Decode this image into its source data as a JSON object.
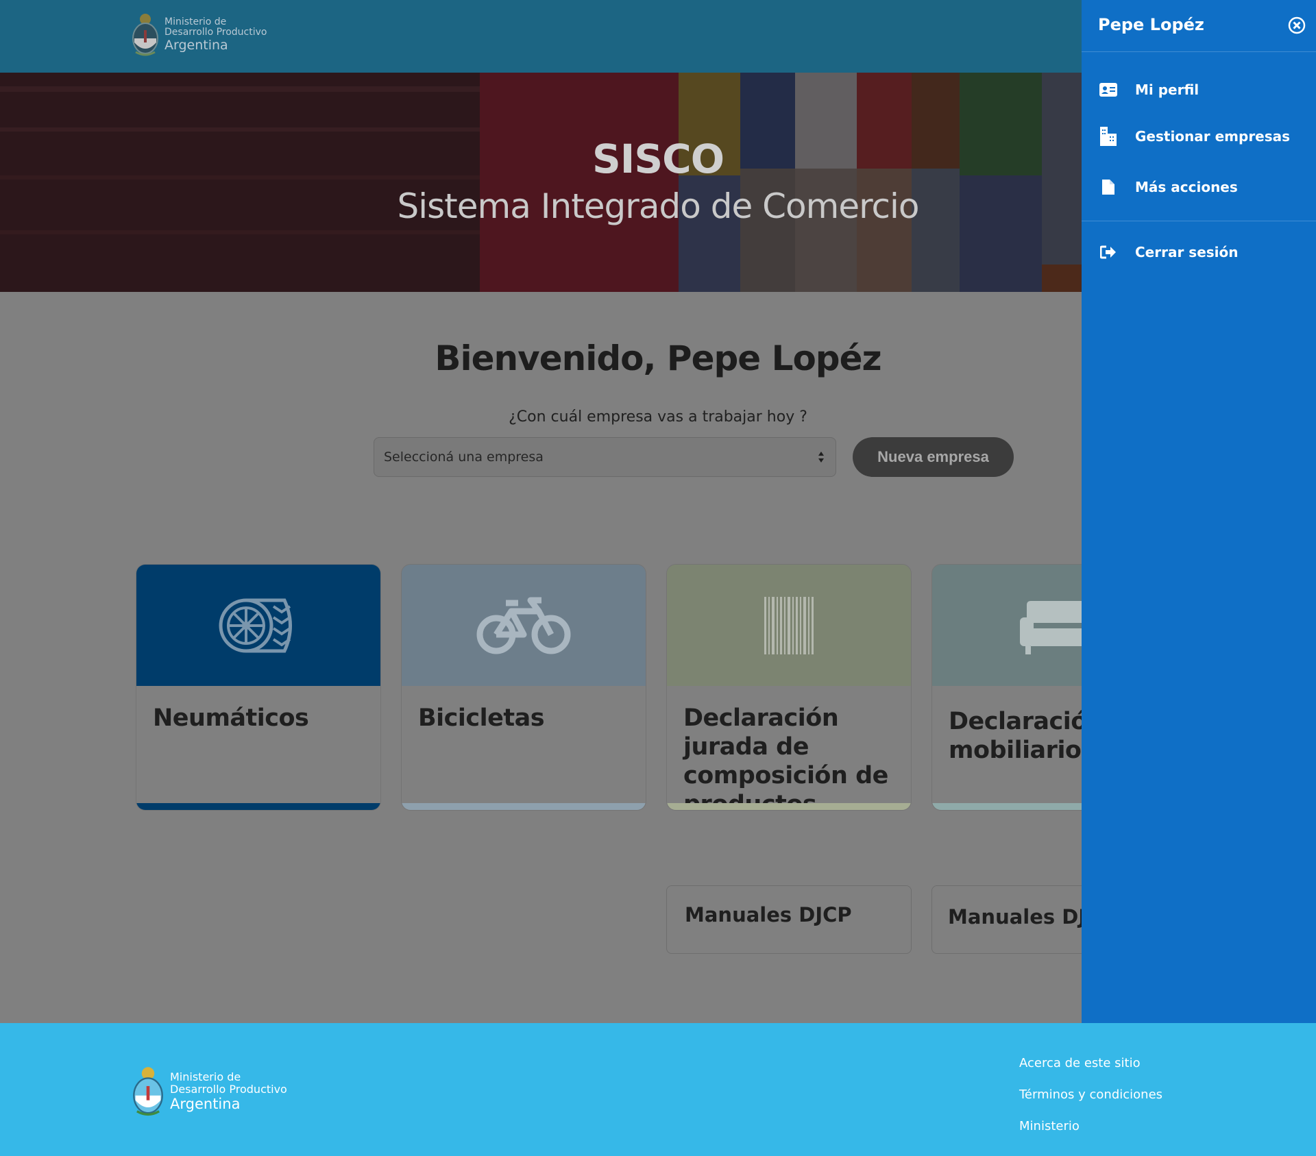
{
  "header": {
    "logo": {
      "line1": "Ministerio de",
      "line2": "Desarrollo Productivo",
      "line3": "Argentina"
    }
  },
  "hero": {
    "title": "SISCO",
    "subtitle": "Sistema Integrado de Comercio"
  },
  "main": {
    "welcome": "Bienvenido, Pepe Lopéz",
    "question": "¿Con cuál empresa vas a trabajar hoy ?",
    "company_select": {
      "value": "Seleccioná una empresa"
    },
    "new_company_label": "Nueva empresa"
  },
  "cards": [
    {
      "label": "Neumáticos",
      "icon": "tire-icon",
      "color": "#003c6a"
    },
    {
      "label": "Bicicletas",
      "icon": "bicycle-icon",
      "color": "#6d7e8b"
    },
    {
      "label": "Declaración jurada de composición de productos",
      "icon": "barcode-icon",
      "color": "#7c8471"
    },
    {
      "label": "Declaración mobiliario",
      "icon": "sofa-icon",
      "color": "#6b7e7f"
    }
  ],
  "manuals": [
    {
      "label": "Manuales DJCP"
    },
    {
      "label": "Manuales DJPM"
    }
  ],
  "footer": {
    "logo": {
      "line1": "Ministerio de",
      "line2": "Desarrollo Productivo",
      "line3": "Argentina"
    },
    "links": [
      "Acerca de este sitio",
      "Términos y condiciones",
      "Ministerio"
    ]
  },
  "panel": {
    "user_name": "Pepe Lopéz",
    "items": [
      {
        "label": "Mi perfil",
        "icon": "id-card-icon"
      },
      {
        "label": "Gestionar empresas",
        "icon": "buildings-icon"
      },
      {
        "label": "Más acciones",
        "icon": "document-icon"
      },
      {
        "label": "Cerrar sesión",
        "icon": "sign-out-icon"
      }
    ]
  },
  "colors": {
    "header_bg": "#1c6583",
    "panel_bg": "#0f6fc6",
    "footer_bg": "#36b8e8",
    "overlay": "#808080"
  }
}
